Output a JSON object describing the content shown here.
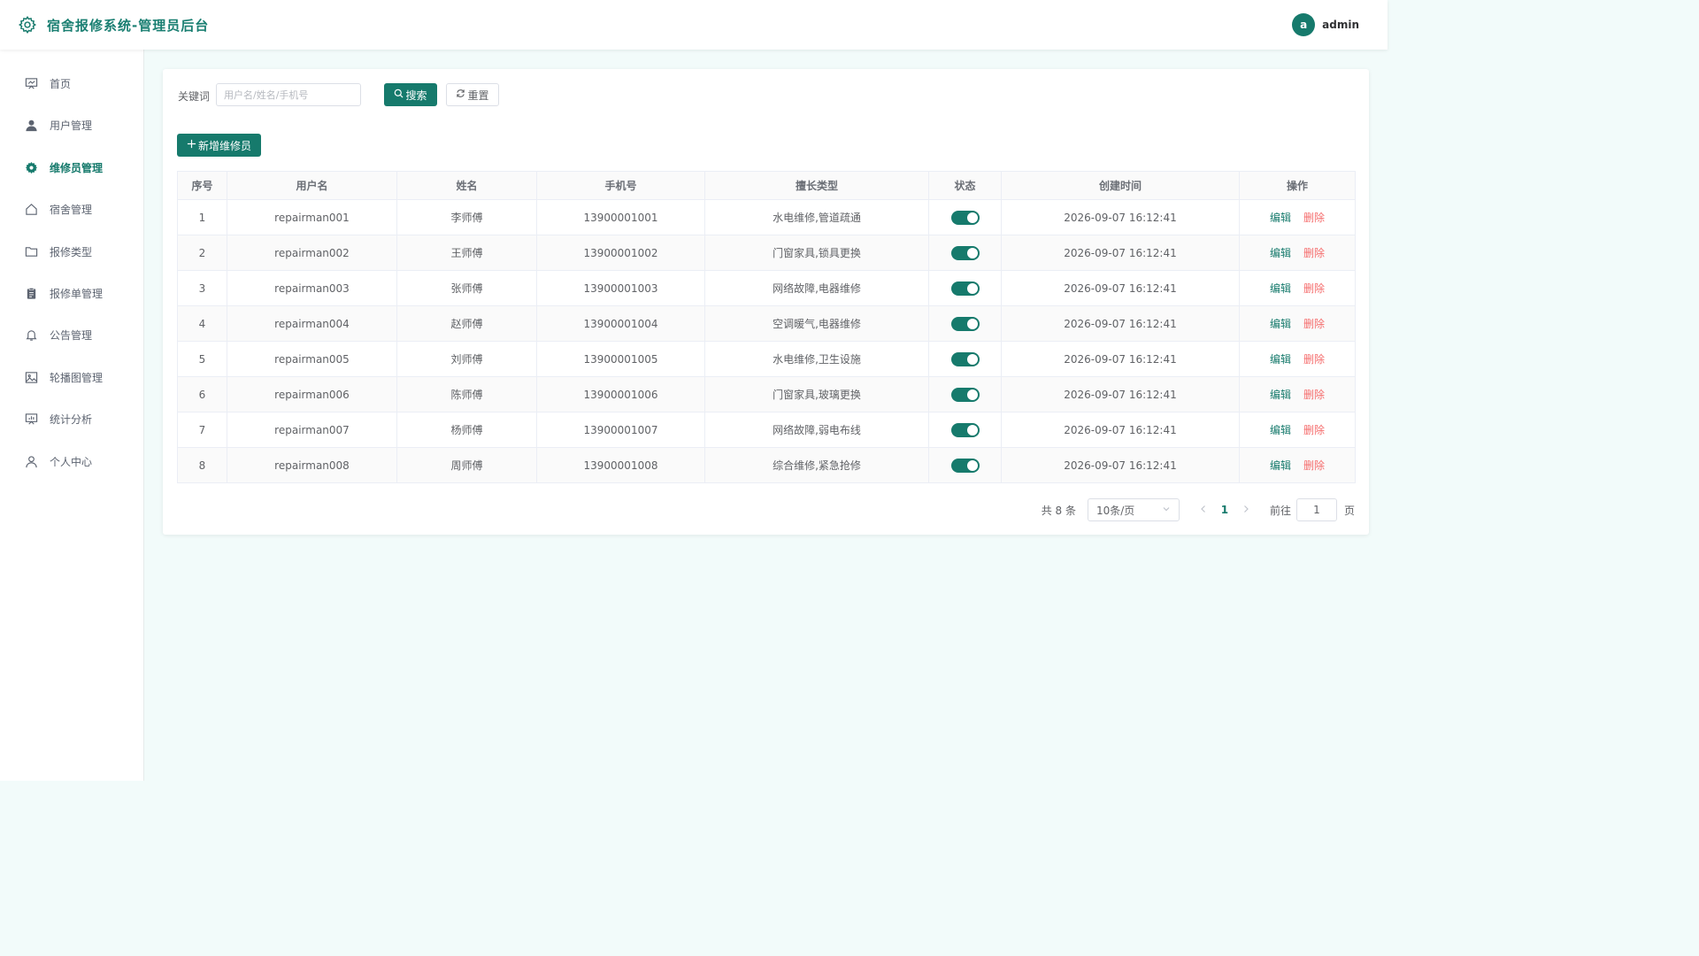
{
  "header": {
    "title": "宿舍报修系统-管理员后台",
    "avatar_initial": "a",
    "username": "admin",
    "brand_icon": "gear-icon"
  },
  "sidebar": {
    "items": [
      {
        "label": "首页",
        "icon": "presentation-board-icon",
        "active": false
      },
      {
        "label": "用户管理",
        "icon": "user-icon",
        "active": false
      },
      {
        "label": "维修员管理",
        "icon": "gear-icon",
        "active": true
      },
      {
        "label": "宿舍管理",
        "icon": "house-icon",
        "active": false
      },
      {
        "label": "报修类型",
        "icon": "folder-icon",
        "active": false
      },
      {
        "label": "报修单管理",
        "icon": "clipboard-icon",
        "active": false
      },
      {
        "label": "公告管理",
        "icon": "bell-icon",
        "active": false
      },
      {
        "label": "轮播图管理",
        "icon": "picture-icon",
        "active": false
      },
      {
        "label": "统计分析",
        "icon": "data-board-icon",
        "active": false
      },
      {
        "label": "个人中心",
        "icon": "user-outline-icon",
        "active": false
      }
    ]
  },
  "search": {
    "label": "关键词",
    "placeholder": "用户名/姓名/手机号",
    "value": "",
    "search_button": "搜索",
    "reset_button": "重置"
  },
  "add_button": "新增维修员",
  "table": {
    "columns": [
      "序号",
      "用户名",
      "姓名",
      "手机号",
      "擅长类型",
      "状态",
      "创建时间",
      "操作"
    ],
    "edit_label": "编辑",
    "delete_label": "删除",
    "rows": [
      {
        "index": "1",
        "username": "repairman001",
        "name": "李师傅",
        "phone": "13900001001",
        "skills": "水电维修,管道疏通",
        "enabled": true,
        "created": "2026-09-07 16:12:41"
      },
      {
        "index": "2",
        "username": "repairman002",
        "name": "王师傅",
        "phone": "13900001002",
        "skills": "门窗家具,锁具更换",
        "enabled": true,
        "created": "2026-09-07 16:12:41"
      },
      {
        "index": "3",
        "username": "repairman003",
        "name": "张师傅",
        "phone": "13900001003",
        "skills": "网络故障,电器维修",
        "enabled": true,
        "created": "2026-09-07 16:12:41"
      },
      {
        "index": "4",
        "username": "repairman004",
        "name": "赵师傅",
        "phone": "13900001004",
        "skills": "空调暖气,电器维修",
        "enabled": true,
        "created": "2026-09-07 16:12:41"
      },
      {
        "index": "5",
        "username": "repairman005",
        "name": "刘师傅",
        "phone": "13900001005",
        "skills": "水电维修,卫生设施",
        "enabled": true,
        "created": "2026-09-07 16:12:41"
      },
      {
        "index": "6",
        "username": "repairman006",
        "name": "陈师傅",
        "phone": "13900001006",
        "skills": "门窗家具,玻璃更换",
        "enabled": true,
        "created": "2026-09-07 16:12:41"
      },
      {
        "index": "7",
        "username": "repairman007",
        "name": "杨师傅",
        "phone": "13900001007",
        "skills": "网络故障,弱电布线",
        "enabled": true,
        "created": "2026-09-07 16:12:41"
      },
      {
        "index": "8",
        "username": "repairman008",
        "name": "周师傅",
        "phone": "13900001008",
        "skills": "综合维修,紧急抢修",
        "enabled": true,
        "created": "2026-09-07 16:12:41"
      }
    ]
  },
  "pagination": {
    "total_text": "共 8 条",
    "page_size": "10条/页",
    "current_page": "1",
    "goto_label": "前往",
    "goto_value": "1",
    "page_suffix": "页"
  },
  "colors": {
    "primary": "#167a6c",
    "danger": "#f56c6c",
    "background": "#f2fbfa"
  }
}
